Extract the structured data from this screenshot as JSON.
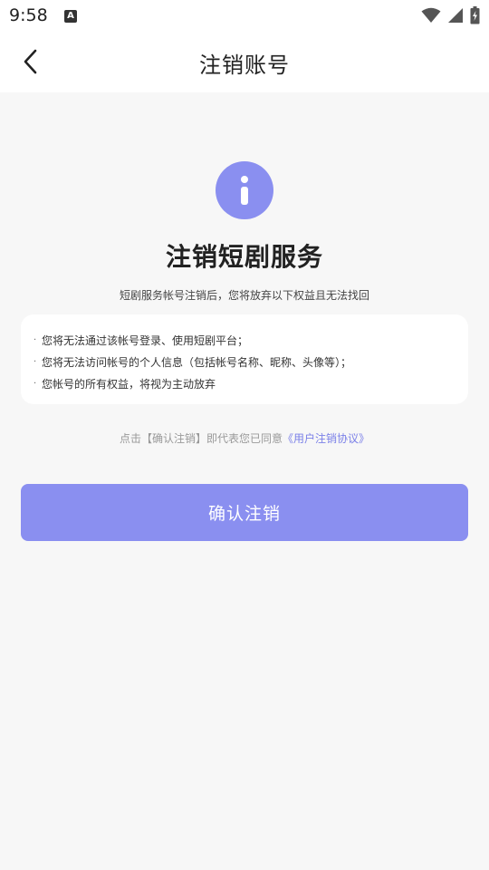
{
  "status_bar": {
    "time": "9:58",
    "notification_icon": "A"
  },
  "header": {
    "back_icon": "chevron-left-icon",
    "title": "注销账号"
  },
  "content": {
    "icon": "info-icon",
    "title": "注销短剧服务",
    "subtitle": "短剧服务帐号注销后，您将放弃以下权益且无法找回",
    "rights": [
      "您将无法通过该帐号登录、使用短剧平台；",
      "您将无法访问帐号的个人信息（包括帐号名称、昵称、头像等）；",
      "您帐号的所有权益，将视为主动放弃"
    ],
    "bullet": "·",
    "agreement_prefix": "点击【确认注销】即代表您已同意",
    "agreement_link": "《用户注销协议》"
  },
  "confirm_button": {
    "label": "确认注销"
  },
  "colors": {
    "accent": "#8a8ff0",
    "link": "#7b80e8",
    "background": "#f7f7f7"
  }
}
